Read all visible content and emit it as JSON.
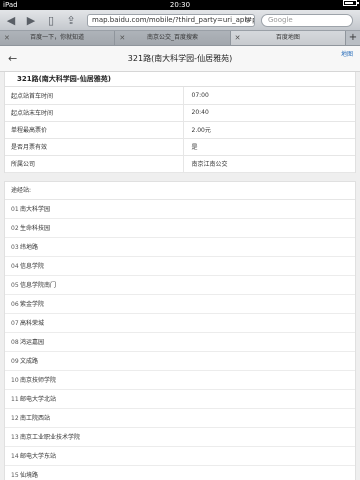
{
  "status": {
    "device": "iPad",
    "time": "20:30"
  },
  "toolbar": {
    "url": "map.baidu.com/mobile/?third_party=uri_api#pla",
    "search_placeholder": "Google"
  },
  "tabs": [
    {
      "label": "百度一下，你就知道",
      "active": false
    },
    {
      "label": "南京公交_百度搜索",
      "active": false
    },
    {
      "label": "百度地图",
      "active": true
    }
  ],
  "header": {
    "title": "321路(南大科学园-仙居雅苑)",
    "map_label": "地图"
  },
  "route": {
    "name": "321路(南大科学园-仙居雅苑)",
    "info": [
      {
        "label": "起点站首车时间",
        "value": "07:00"
      },
      {
        "label": "起点站末车时间",
        "value": "20:40"
      },
      {
        "label": "单程最高票价",
        "value": "2.00元"
      },
      {
        "label": "是否月票有效",
        "value": "是"
      },
      {
        "label": "所属公司",
        "value": "南京江南公交"
      }
    ]
  },
  "stops": {
    "heading": "途经站:",
    "items": [
      {
        "num": "01",
        "name": "南大科学园"
      },
      {
        "num": "02",
        "name": "生命科技园"
      },
      {
        "num": "03",
        "name": "纬地路"
      },
      {
        "num": "04",
        "name": "信息学院"
      },
      {
        "num": "05",
        "name": "信息学院南门"
      },
      {
        "num": "06",
        "name": "紫金学院"
      },
      {
        "num": "07",
        "name": "高科荣城"
      },
      {
        "num": "08",
        "name": "鸿运嘉园"
      },
      {
        "num": "09",
        "name": "文成路"
      },
      {
        "num": "10",
        "name": "南京技师学院"
      },
      {
        "num": "11",
        "name": "邮电大学北站"
      },
      {
        "num": "12",
        "name": "南工院西站"
      },
      {
        "num": "13",
        "name": "南京工业职业技术学院"
      },
      {
        "num": "14",
        "name": "邮电大学东站"
      },
      {
        "num": "15",
        "name": "仙境路"
      }
    ]
  }
}
